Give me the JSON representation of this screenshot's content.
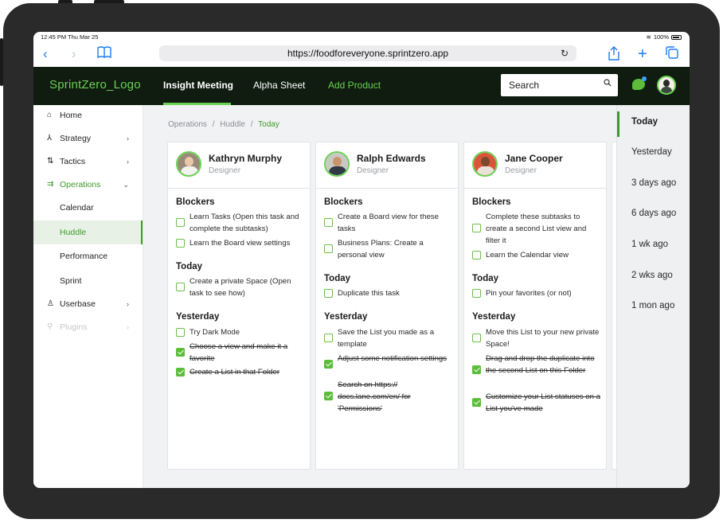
{
  "status_bar": {
    "time": "12:45 PM  Thu Mar 25",
    "battery": "100%"
  },
  "browser": {
    "url": "https://foodforeveryone.sprintzero.app",
    "icons": {
      "back": "chevron-left-icon",
      "forward": "chevron-right-icon",
      "bookmarks": "book-icon",
      "reload": "reload-icon",
      "share": "share-icon",
      "new_tab": "plus-icon",
      "tabs": "tabs-icon"
    }
  },
  "header": {
    "logo": "SprintZero_Logo",
    "tabs": [
      {
        "label": "Insight Meeting"
      },
      {
        "label": "Alpha Sheet"
      },
      {
        "label": "Add Product"
      }
    ],
    "search_placeholder": "Search",
    "accent": "#6bd154"
  },
  "sidebar": {
    "items": [
      {
        "label": "Home",
        "icon": "home-icon"
      },
      {
        "label": "Strategy",
        "icon": "strategy-icon"
      },
      {
        "label": "Tactics",
        "icon": "tactics-icon"
      },
      {
        "label": "Operations",
        "icon": "operations-icon"
      }
    ],
    "sub_items": [
      {
        "label": "Calendar"
      },
      {
        "label": "Huddle"
      },
      {
        "label": "Performance"
      },
      {
        "label": "Sprint"
      }
    ],
    "bottom_items": [
      {
        "label": "Userbase",
        "icon": "user-icon"
      },
      {
        "label": "Plugins",
        "icon": "plugin-icon"
      }
    ]
  },
  "breadcrumb": {
    "part1": "Operations",
    "part2": "Huddle",
    "current": "Today",
    "sep": "/"
  },
  "cards": [
    {
      "name": "Kathryn Murphy",
      "role": "Designer",
      "blockers_title": "Blockers",
      "blockers": [
        {
          "text": "Learn Tasks (Open this task and complete the subtasks)",
          "done": false
        },
        {
          "text": "Learn the Board view settings",
          "done": false
        }
      ],
      "today_title": "Today",
      "today": [
        {
          "text": "Create a private Space (Open task to see how)",
          "done": false
        }
      ],
      "yesterday_title": "Yesterday",
      "yesterday": [
        {
          "text": "Try Dark Mode",
          "done": false
        },
        {
          "text": "Choose a view and make it a favorite",
          "done": true
        },
        {
          "text": "Create a List in that Folder",
          "done": true
        }
      ]
    },
    {
      "name": "Ralph Edwards",
      "role": "Designer",
      "blockers_title": "Blockers",
      "blockers": [
        {
          "text": "Create a Board view for these tasks",
          "done": false
        },
        {
          "text": "Business Plans: Create a personal view",
          "done": false
        }
      ],
      "today_title": "Today",
      "today": [
        {
          "text": "Duplicate this task",
          "done": false
        }
      ],
      "yesterday_title": "Yesterday",
      "yesterday": [
        {
          "text": "Save the List you made as a template",
          "done": false
        },
        {
          "text": "Adjust some notification settings",
          "done": true
        },
        {
          "text": "Search on https:// docs.lane.com/en/ for 'Permissions'",
          "done": true
        }
      ]
    },
    {
      "name": "Jane Cooper",
      "role": "Designer",
      "blockers_title": "Blockers",
      "blockers": [
        {
          "text": "Complete these subtasks to create a second List view and filter it",
          "done": false
        },
        {
          "text": "Learn the Calendar view",
          "done": false
        }
      ],
      "today_title": "Today",
      "today": [
        {
          "text": "Pin your favorites (or not)",
          "done": false
        }
      ],
      "yesterday_title": "Yesterday",
      "yesterday": [
        {
          "text": "Move this List to your new private Space!",
          "done": false
        },
        {
          "text": "Drag and drop the duplicate into the second List on this Folder",
          "done": true
        },
        {
          "text": "Customize your List statuses on a List you've made",
          "done": true
        }
      ]
    }
  ],
  "history": [
    {
      "label": "Today"
    },
    {
      "label": "Yesterday"
    },
    {
      "label": "3 days ago"
    },
    {
      "label": "6 days ago"
    },
    {
      "label": "1 wk ago"
    },
    {
      "label": "2 wks ago"
    },
    {
      "label": "1 mon ago"
    }
  ]
}
